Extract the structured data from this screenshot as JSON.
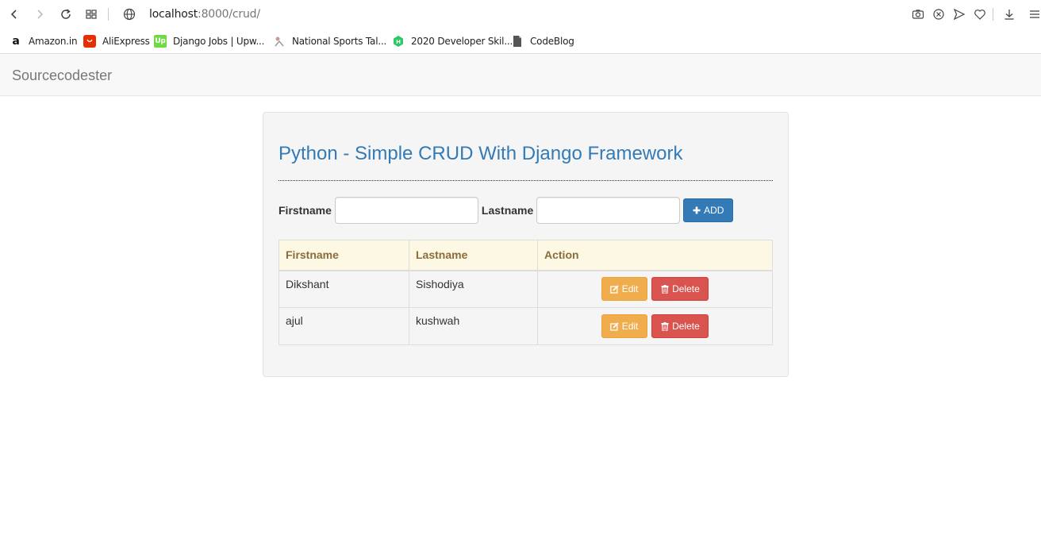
{
  "browser": {
    "url_host": "localhost",
    "url_rest": ":8000/crud/",
    "bookmarks": [
      {
        "label": "Amazon.in",
        "icon": "amazon-icon"
      },
      {
        "label": "AliExpress",
        "icon": "aliexpress-icon"
      },
      {
        "label": "Django Jobs | Upw...",
        "icon": "upwork-icon"
      },
      {
        "label": "National Sports Tal...",
        "icon": "sports-icon"
      },
      {
        "label": "2020 Developer Skil...",
        "icon": "hackerrank-icon"
      },
      {
        "label": "CodeBlog",
        "icon": "document-icon"
      }
    ]
  },
  "navbar": {
    "brand": "Sourcecodester"
  },
  "main": {
    "title": "Python - Simple CRUD With Django Framework",
    "form": {
      "firstname_label": "Firstname",
      "lastname_label": "Lastname",
      "add_label": "ADD",
      "firstname_value": "",
      "lastname_value": ""
    },
    "table": {
      "headers": [
        "Firstname",
        "Lastname",
        "Action"
      ],
      "rows": [
        {
          "firstname": "Dikshant",
          "lastname": "Sishodiya"
        },
        {
          "firstname": "ajul",
          "lastname": "kushwah"
        }
      ],
      "edit_label": "Edit",
      "delete_label": "Delete"
    }
  },
  "colors": {
    "primary": "#337ab7",
    "warning": "#f0ad4e",
    "danger": "#d9534f",
    "table_header_bg": "#fcf8e3"
  }
}
